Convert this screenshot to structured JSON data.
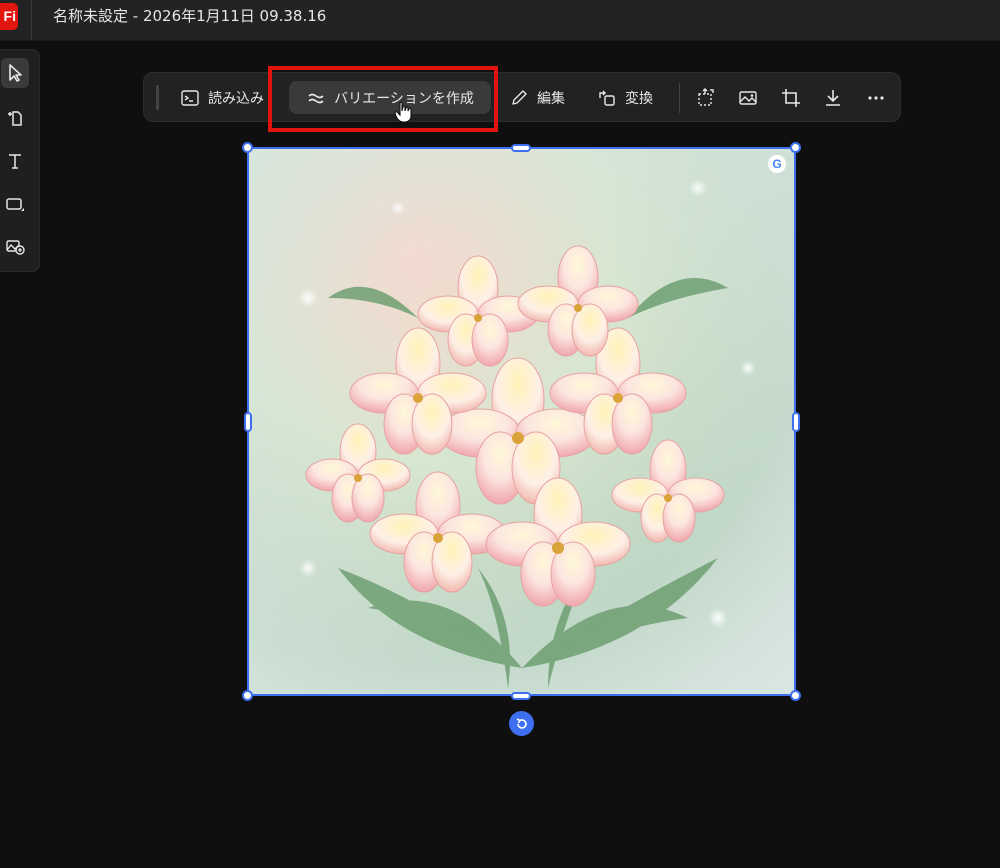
{
  "app": {
    "logo_text": "Fi",
    "brand_color": "#e3150f"
  },
  "document": {
    "title": "名称未設定 - 2026年1月11日 09.38.16"
  },
  "tools": [
    {
      "name": "select-tool",
      "icon": "pointer-arrow-icon",
      "active": true
    },
    {
      "name": "insert-page-tool",
      "icon": "add-page-icon"
    },
    {
      "name": "text-tool",
      "icon": "text-icon"
    },
    {
      "name": "shape-tool",
      "icon": "rectangle-icon"
    },
    {
      "name": "generate-image-tool",
      "icon": "image-add-icon"
    }
  ],
  "toolbar": {
    "import_label": "読み込み",
    "variation_label": "バリエーションを作成",
    "edit_label": "編集",
    "transform_label": "変換",
    "icons": [
      "expand-icon",
      "image-icon",
      "crop-icon",
      "download-icon",
      "more-icon"
    ]
  },
  "canvas": {
    "image_alt": "Alstroemeria flower bouquet illustration",
    "badge": "G",
    "selection_color": "#3d6ff0"
  }
}
